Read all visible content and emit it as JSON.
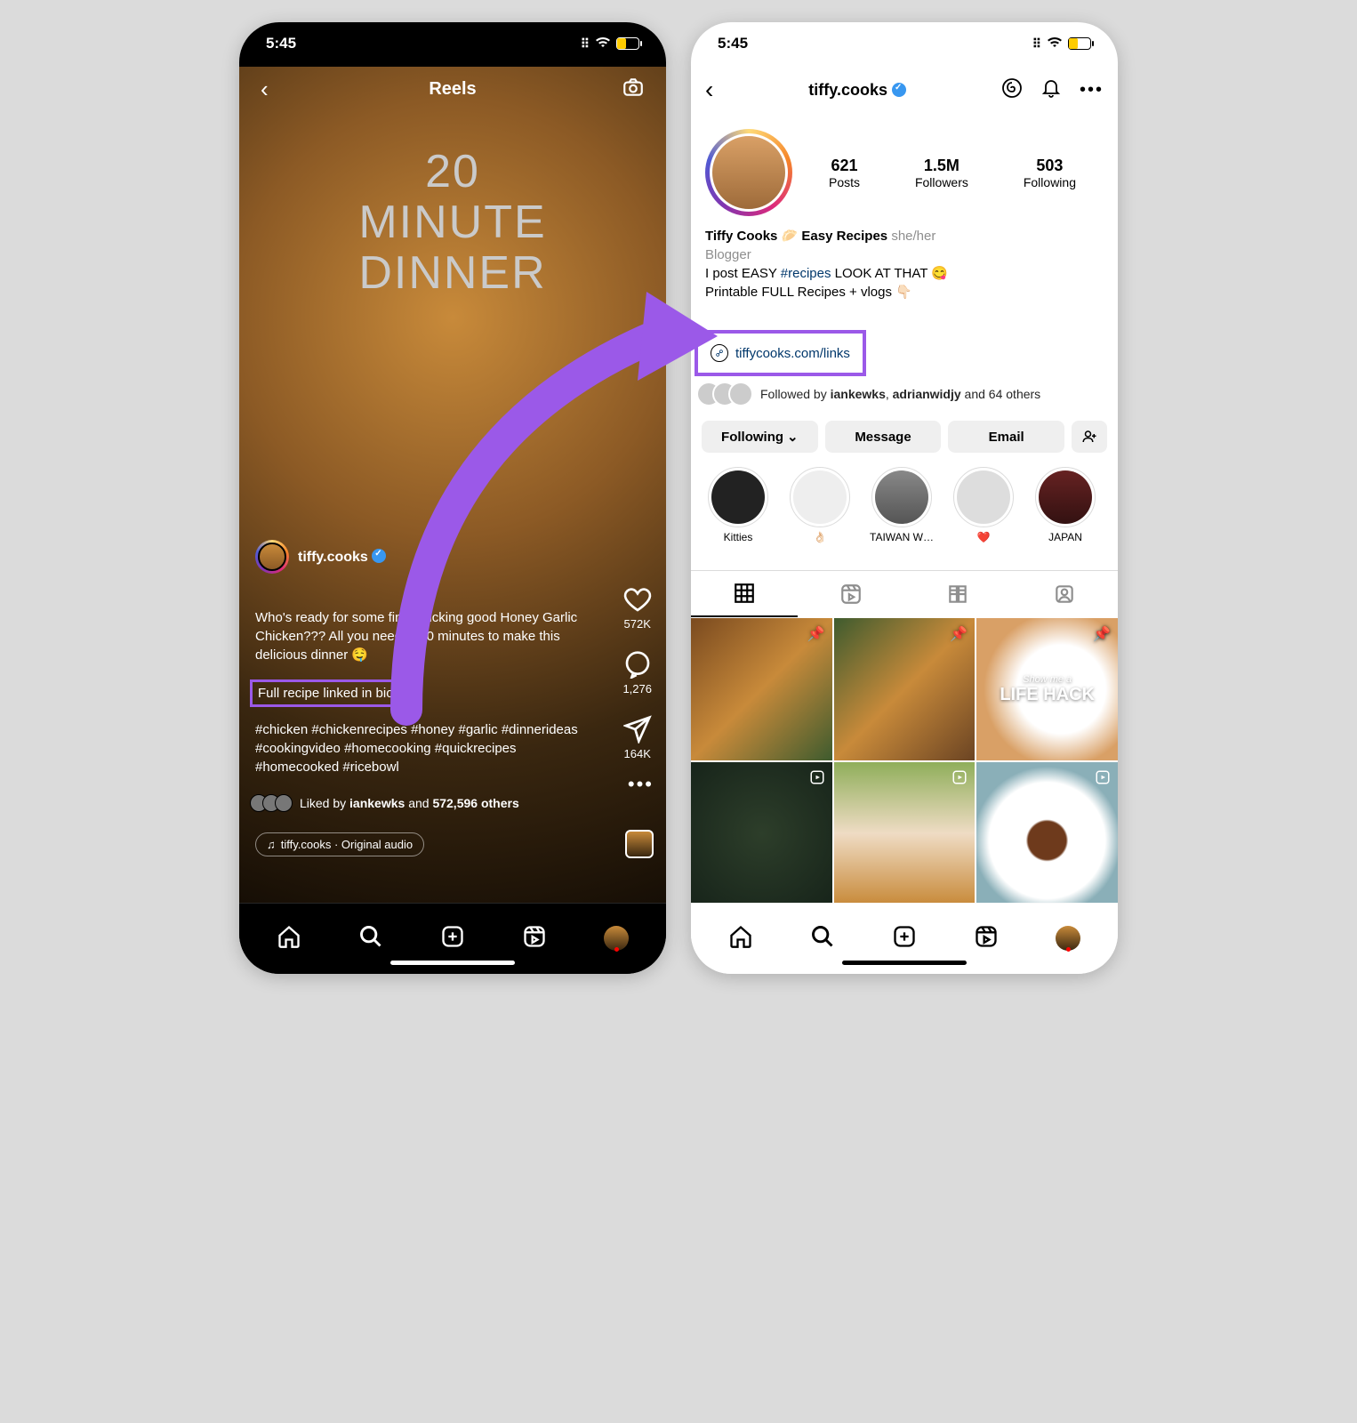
{
  "status": {
    "time": "5:45"
  },
  "reel": {
    "header": "Reels",
    "overlay_line1": "20 MINUTE",
    "overlay_line2": "DINNER",
    "username": "tiffy.cooks",
    "caption": "Who's ready for some finger-licking good Honey Garlic Chicken??? All you need is 20 minutes to make this delicious dinner 🤤",
    "bio_line": "Full recipe linked in bio :)",
    "hashtags": "#chicken #chickenrecipes #honey #garlic #dinnerideas #cookingvideo #homecooking #quickrecipes #homecooked #ricebowl",
    "liked_prefix": "Liked by ",
    "liked_user": "iankewks",
    "liked_and": " and ",
    "liked_others": "572,596 others",
    "audio": "tiffy.cooks · Original audio",
    "likes": "572K",
    "comments": "1,276",
    "shares": "164K"
  },
  "profile": {
    "handle": "tiffy.cooks",
    "stats": {
      "posts_n": "621",
      "posts_l": "Posts",
      "followers_n": "1.5M",
      "followers_l": "Followers",
      "following_n": "503",
      "following_l": "Following"
    },
    "display_name": "Tiffy Cooks 🥟 Easy Recipes",
    "pronouns": "she/her",
    "category": "Blogger",
    "bio_prefix": "I post EASY ",
    "bio_hashtag": "#recipes",
    "bio_suffix": " LOOK AT THAT 😋",
    "bio_line2": "Printable FULL Recipes + vlogs 👇🏻",
    "link": "tiffycooks.com/links",
    "followed_prefix": "Followed by ",
    "followed_u1": "iankewks",
    "followed_c1": ", ",
    "followed_u2": "adrianwidjy",
    "followed_suffix": " and 64 others",
    "actions": {
      "following": "Following",
      "message": "Message",
      "email": "Email"
    },
    "highlights": [
      "Kitties",
      "👌🏻",
      "TAIWAN W…",
      "❤️",
      "JAPAN"
    ],
    "grid_overlay": {
      "showme": "Show me a",
      "lifehack": "LIFE HACK"
    }
  }
}
